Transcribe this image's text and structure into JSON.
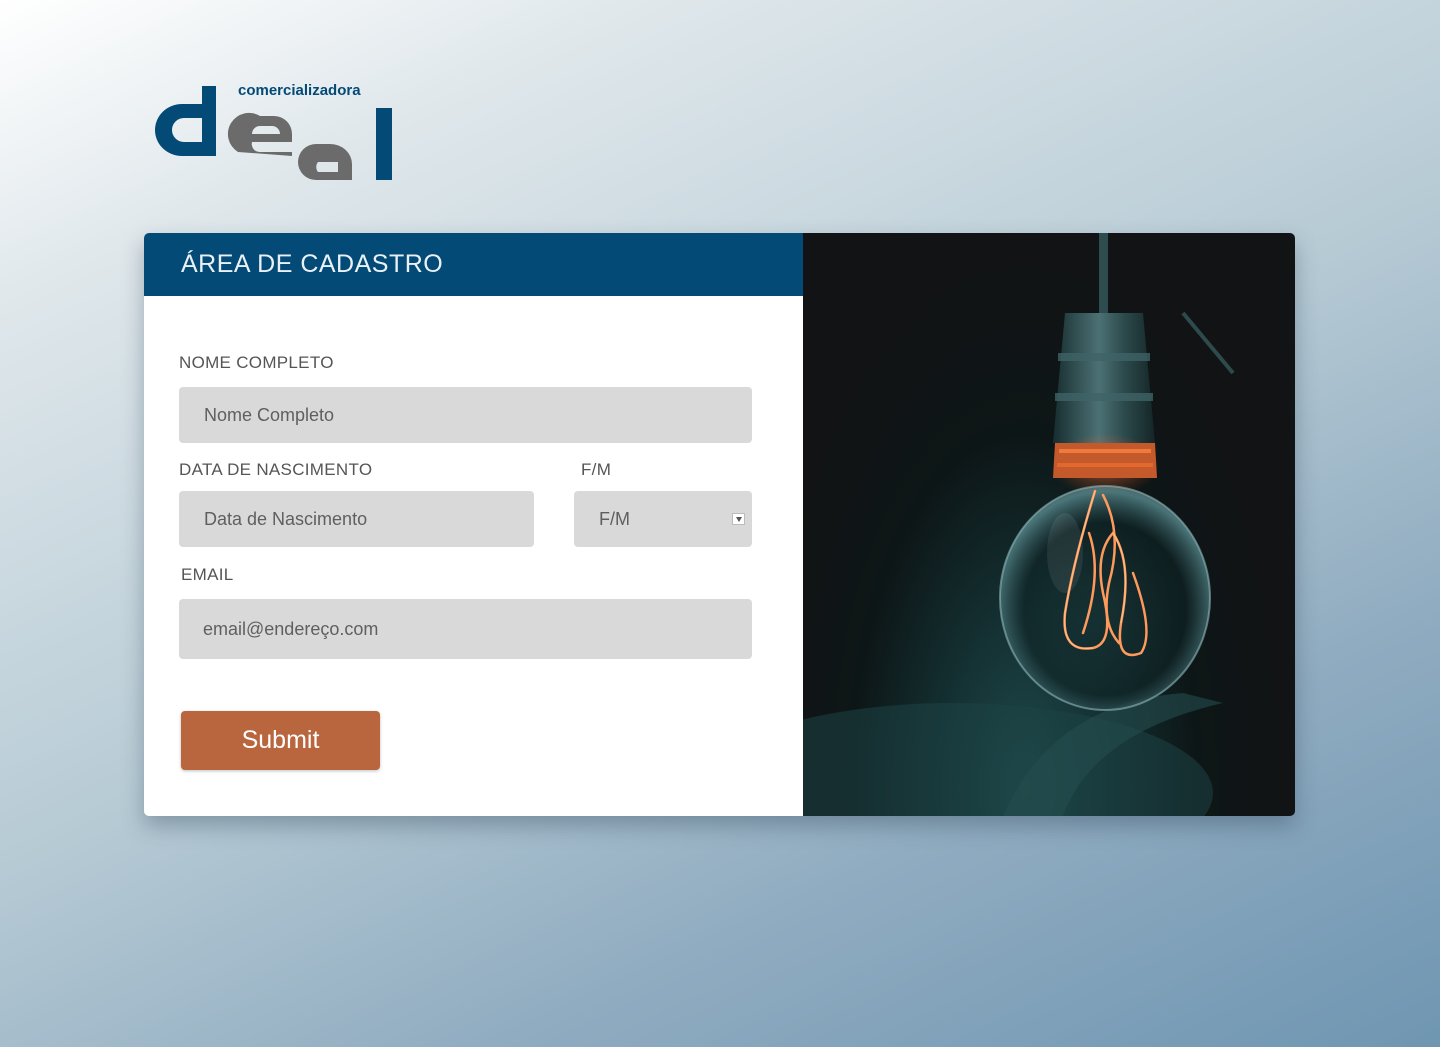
{
  "brand": {
    "tagline": "comercializadora",
    "name": "deal",
    "colors": {
      "blue": "#044a76",
      "gray": "#6b6b6b"
    }
  },
  "form": {
    "title": "ÁREA DE CADASTRO",
    "fields": {
      "full_name": {
        "label": "NOME COMPLETO",
        "placeholder": "Nome Completo"
      },
      "birth_date": {
        "label": "DATA DE NASCIMENTO",
        "placeholder": "Data de Nascimento"
      },
      "gender": {
        "label": "F/M",
        "selected": "F/M"
      },
      "email": {
        "label": "EMAIL",
        "placeholder": "email@endereço.com"
      }
    },
    "submit_label": "Submit",
    "colors": {
      "header": "#044a76",
      "submit": "#b9653e",
      "input": "#d9d9d9"
    }
  },
  "image": {
    "subject": "lightbulb-with-glowing-filament"
  }
}
